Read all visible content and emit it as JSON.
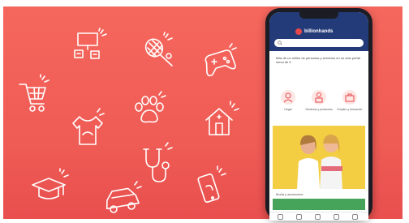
{
  "colors": {
    "banner": "#f05f58",
    "line_icons": "#ffffff",
    "phone_body": "#1c1c24",
    "app_header": "#233b78",
    "brand_accent": "#e8474a",
    "photo_background": "#f3cd42"
  },
  "illustration_icons": [
    "presentation-board-icon",
    "tennis-racket-icon",
    "gamepad-icon",
    "shopping-cart-icon",
    "paw-print-icon",
    "house-icon",
    "t-shirt-icon",
    "stethoscope-icon",
    "graduation-cap-icon",
    "car-icon",
    "mobile-phone-icon"
  ],
  "app": {
    "logo_text": "billionhands",
    "search_placeholder": "",
    "intro_text": "Más de un millón de personas y servicios en un sólo portal cerca de ti",
    "categories": [
      {
        "label": "Hogar",
        "icon": "user-icon"
      },
      {
        "label": "Servicios y productos",
        "icon": "service-icon"
      },
      {
        "label": "Empleo y formación",
        "icon": "bag-icon"
      }
    ],
    "featured_caption": "Moda y accesorios",
    "bottom_nav": [
      "home-nav-icon",
      "search-nav-icon",
      "add-nav-icon",
      "chat-nav-icon",
      "profile-nav-icon"
    ]
  }
}
